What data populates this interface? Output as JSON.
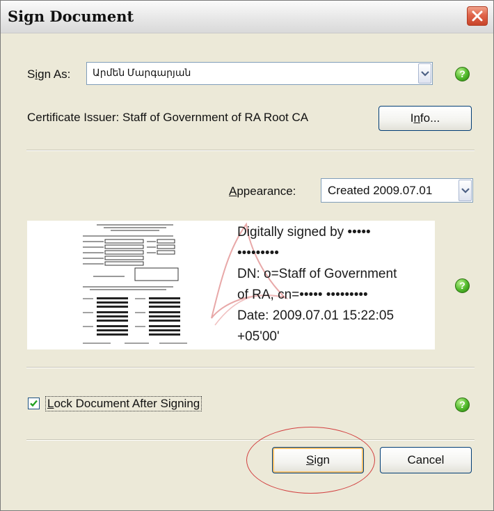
{
  "window": {
    "title": "Sign Document"
  },
  "sign_as": {
    "label": "Sign As:",
    "label_mnemonic": "i",
    "label_pre": "S",
    "label_post": "gn As:",
    "value": "Արմեն Մարգարյան"
  },
  "certificate": {
    "text": "Certificate Issuer: Staff of Government of RA Root CA",
    "info_button_pre": "I",
    "info_button_mnemonic": "n",
    "info_button_post": "fo...",
    "info_button_label": "Info..."
  },
  "appearance": {
    "label": "Appearance:",
    "label_mnemonic": "A",
    "label_post": "ppearance:",
    "value": "Created 2009.07.01"
  },
  "preview": {
    "lines": [
      "Digitally signed by •••••",
      "•••••••••",
      "DN: o=Staff of Government",
      "of RA, cn=••••• •••••••••",
      "Date: 2009.07.01 15:22:05",
      "+05'00'"
    ]
  },
  "lock": {
    "label": "Lock Document After Signing",
    "label_mnemonic": "L",
    "label_post": "ock Document After Signing",
    "checked": true
  },
  "buttons": {
    "sign_mnemonic": "S",
    "sign_post": "ign",
    "sign_label": "Sign",
    "cancel_label": "Cancel"
  },
  "colors": {
    "accent_help": "#4fb82a",
    "close_red": "#e0644a",
    "highlight_oval": "#d24040"
  },
  "icons": {
    "close": "close-icon",
    "help": "help-icon",
    "dropdown": "chevron-down-icon",
    "check": "checkmark-icon"
  }
}
